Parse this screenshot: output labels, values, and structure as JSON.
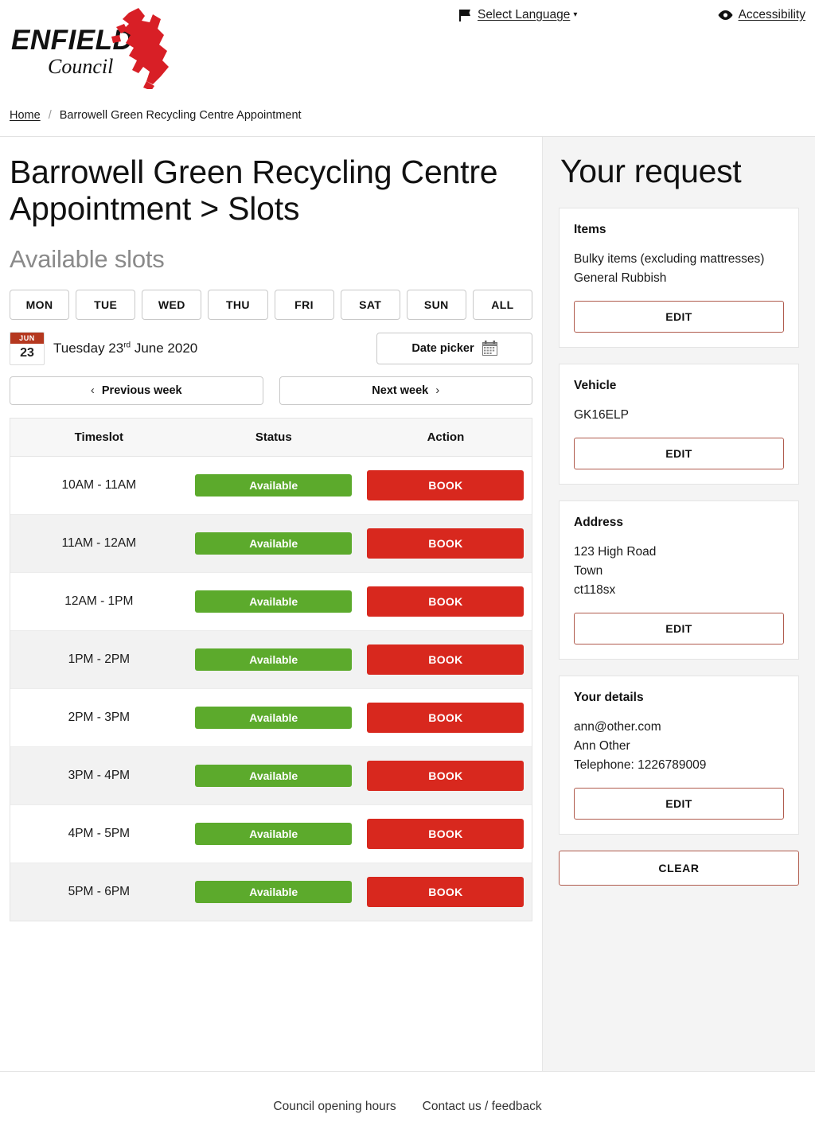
{
  "header": {
    "logo_line1": "ENFIELD",
    "logo_line2": "Council",
    "language_label": "Select Language",
    "language_caret": "▾",
    "accessibility_label": "Accessibility"
  },
  "breadcrumb": {
    "home": "Home",
    "separator": "/",
    "current": "Barrowell Green Recycling Centre Appointment"
  },
  "main": {
    "title": "Barrowell Green Recycling Centre Appointment > Slots",
    "subtitle": "Available slots",
    "day_tabs": [
      "MON",
      "TUE",
      "WED",
      "THU",
      "FRI",
      "SAT",
      "SUN",
      "ALL"
    ],
    "date_badge": {
      "month": "JUN",
      "day": "23"
    },
    "date_text_prefix": "Tuesday 23",
    "date_text_ordinal": "rd",
    "date_text_suffix": " June 2020",
    "date_picker_label": "Date picker",
    "previous_week_label": "Previous week",
    "next_week_label": "Next week",
    "prev_chevron": "‹",
    "next_chevron": "›",
    "table": {
      "columns": [
        "Timeslot",
        "Status",
        "Action"
      ],
      "rows": [
        {
          "timeslot": "10AM - 11AM",
          "status": "Available",
          "action": "BOOK"
        },
        {
          "timeslot": "11AM - 12AM",
          "status": "Available",
          "action": "BOOK"
        },
        {
          "timeslot": "12AM - 1PM",
          "status": "Available",
          "action": "BOOK"
        },
        {
          "timeslot": "1PM - 2PM",
          "status": "Available",
          "action": "BOOK"
        },
        {
          "timeslot": "2PM - 3PM",
          "status": "Available",
          "action": "BOOK"
        },
        {
          "timeslot": "3PM - 4PM",
          "status": "Available",
          "action": "BOOK"
        },
        {
          "timeslot": "4PM - 5PM",
          "status": "Available",
          "action": "BOOK"
        },
        {
          "timeslot": "5PM - 6PM",
          "status": "Available",
          "action": "BOOK"
        }
      ]
    }
  },
  "sidebar": {
    "title": "Your request",
    "cards": [
      {
        "heading": "Items",
        "lines": [
          "Bulky items (excluding mattresses)",
          "General Rubbish"
        ],
        "button": "EDIT"
      },
      {
        "heading": "Vehicle",
        "lines": [
          "GK16ELP"
        ],
        "button": "EDIT"
      },
      {
        "heading": "Address",
        "lines": [
          "123 High Road",
          "Town",
          "ct118sx"
        ],
        "button": "EDIT"
      },
      {
        "heading": "Your details",
        "lines": [
          "ann@other.com",
          "Ann Other",
          "Telephone: 1226789009"
        ],
        "button": "EDIT"
      }
    ],
    "clear_label": "CLEAR"
  },
  "footer": {
    "links": [
      "Council opening hours",
      "Contact us / feedback"
    ]
  },
  "colors": {
    "brand_red": "#d8281e",
    "badge_red": "#b5381f",
    "available_green": "#5caa2c",
    "edit_border": "#b05b4d",
    "sidebar_bg": "#f4f4f4"
  },
  "icons": {
    "flag": "flag-icon",
    "eye": "eye-icon",
    "calendar": "calendar-icon"
  }
}
